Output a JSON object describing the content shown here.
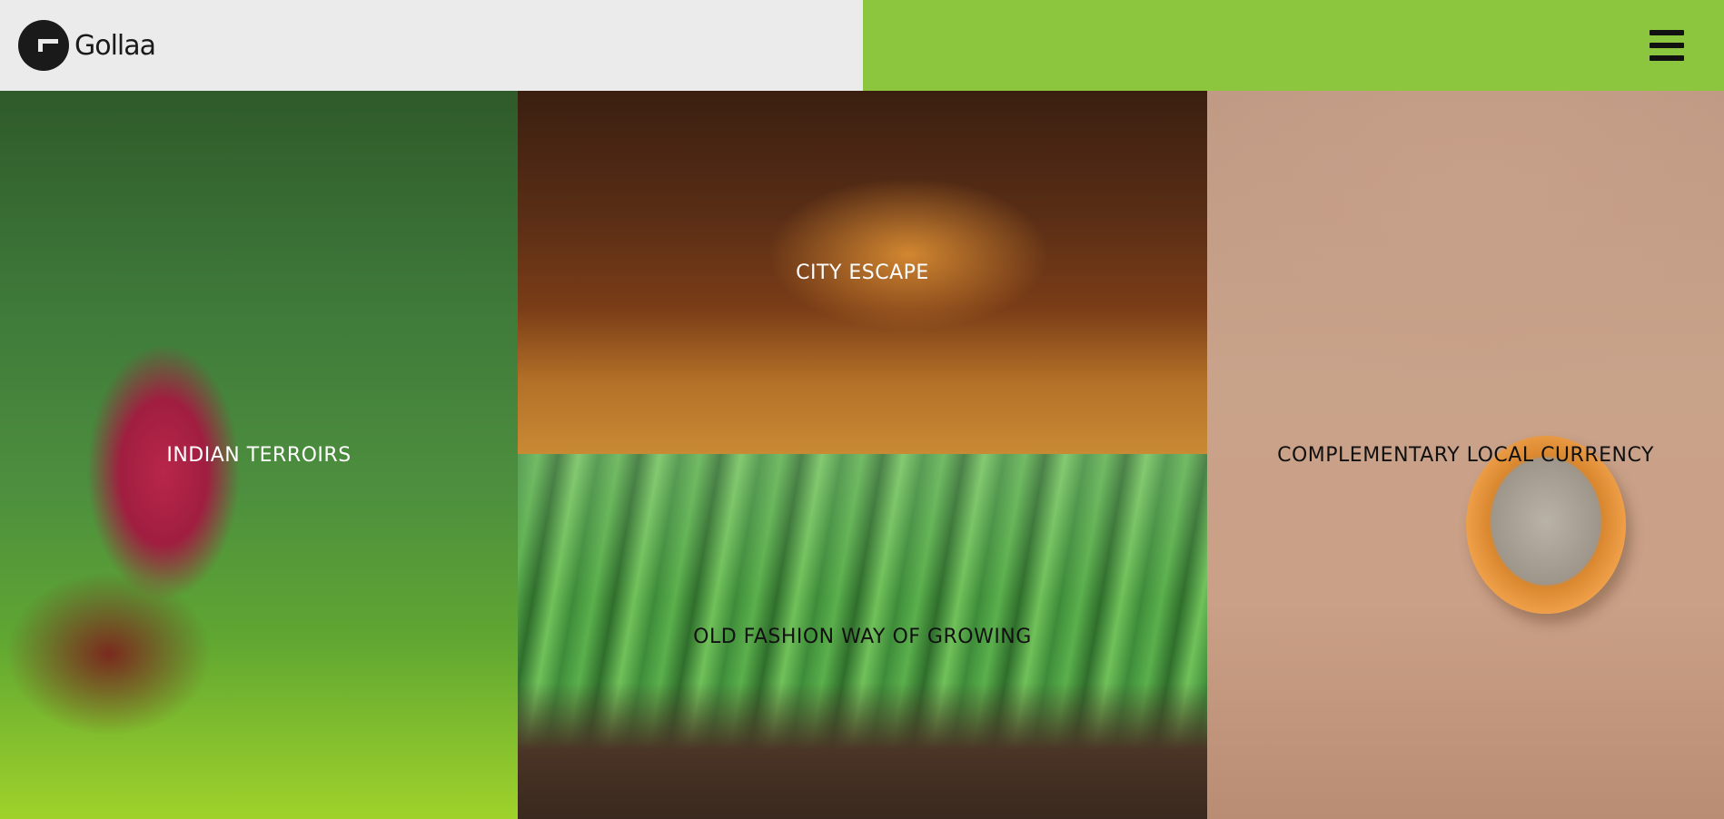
{
  "header": {
    "brand": "Gollaa",
    "menu_icon": "hamburger-menu-icon",
    "colors": {
      "left_bg": "#ebebeb",
      "right_bg": "#8cc63f"
    }
  },
  "tiles": [
    {
      "title": "INDIAN TERROIRS",
      "text_color": "#ffffff"
    },
    {
      "title": "CITY ESCAPE",
      "text_color": "#ffffff"
    },
    {
      "title": "OLD FASHION WAY OF GROWING",
      "text_color": "#111111"
    },
    {
      "title": "COMPLEMENTARY LOCAL CURRENCY",
      "text_color": "#111111"
    }
  ]
}
